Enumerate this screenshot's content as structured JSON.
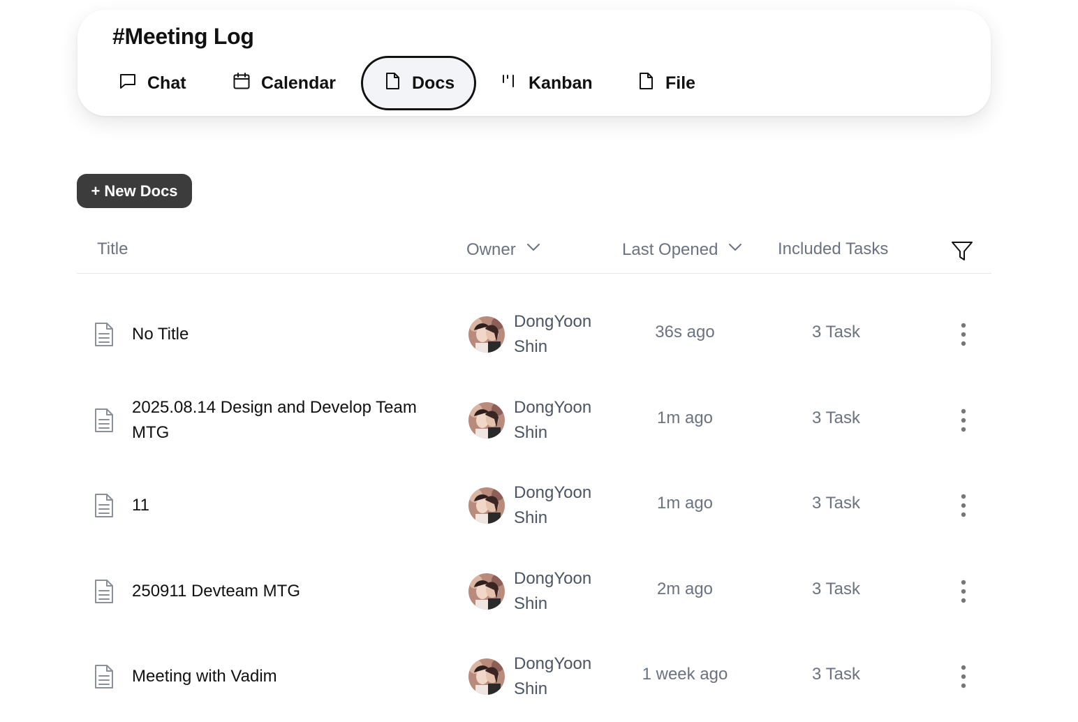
{
  "header": {
    "channel_title": "#Meeting Log",
    "tabs": [
      {
        "label": "Chat",
        "icon": "chat-bubble-icon",
        "active": false
      },
      {
        "label": "Calendar",
        "icon": "calendar-icon",
        "active": false
      },
      {
        "label": "Docs",
        "icon": "document-icon",
        "active": true
      },
      {
        "label": "Kanban",
        "icon": "kanban-icon",
        "active": false
      },
      {
        "label": "File",
        "icon": "file-icon",
        "active": false
      }
    ]
  },
  "toolbar": {
    "new_docs_label": "+ New Docs"
  },
  "table": {
    "columns": {
      "title": "Title",
      "owner": "Owner",
      "last_opened": "Last Opened",
      "included_tasks": "Included Tasks"
    },
    "rows": [
      {
        "title": "No Title",
        "owner": "DongYoon Shin",
        "last_opened": "36s ago",
        "tasks": "3 Task"
      },
      {
        "title": "2025.08.14 Design and Develop Team MTG",
        "owner": "DongYoon Shin",
        "last_opened": "1m ago",
        "tasks": "3 Task"
      },
      {
        "title": "11",
        "owner": "DongYoon Shin",
        "last_opened": "1m ago",
        "tasks": "3 Task"
      },
      {
        "title": "250911 Devteam MTG",
        "owner": "DongYoon Shin",
        "last_opened": "2m ago",
        "tasks": "3 Task"
      },
      {
        "title": "Meeting with Vadim",
        "owner": "DongYoon Shin",
        "last_opened": "1 week ago",
        "tasks": "3 Task"
      }
    ]
  },
  "colors": {
    "text_primary": "#111111",
    "text_secondary": "#6b7280",
    "button_dark": "#3c3c3c",
    "active_tab_bg": "#f2f4f7",
    "divider": "#e4e6ea"
  }
}
